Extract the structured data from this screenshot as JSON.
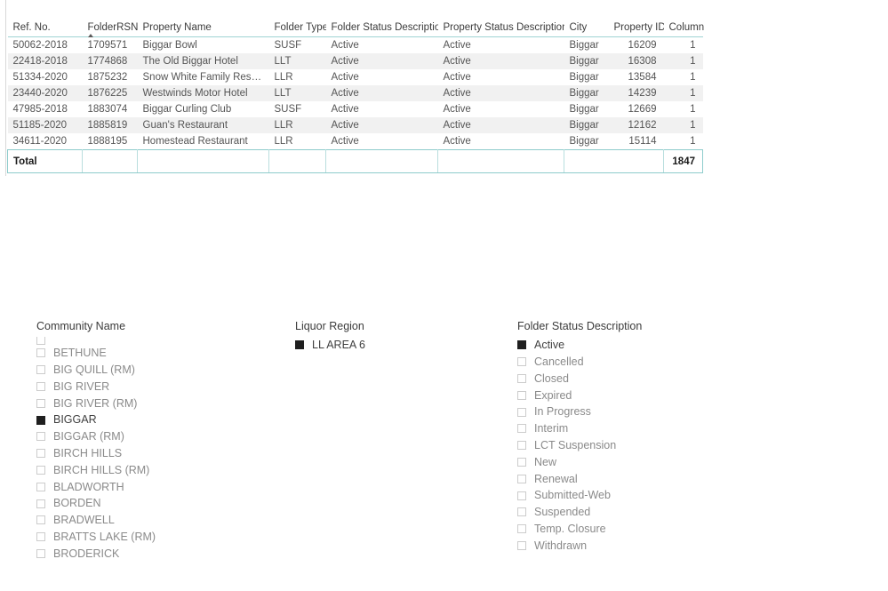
{
  "table": {
    "name": "property-folder-table",
    "columns": [
      {
        "key": "ref_no",
        "label": "Ref. No.",
        "align": "left",
        "sorted": false
      },
      {
        "key": "folder_rsn",
        "label": "FolderRSN",
        "align": "left",
        "sorted": true,
        "sort_direction": "asc"
      },
      {
        "key": "property_name",
        "label": "Property Name",
        "align": "left",
        "sorted": false
      },
      {
        "key": "folder_type",
        "label": "Folder Type",
        "align": "left",
        "sorted": false
      },
      {
        "key": "folder_status_description",
        "label": "Folder Status Description",
        "align": "left",
        "sorted": false
      },
      {
        "key": "property_status_description",
        "label": "Property Status Description",
        "align": "left",
        "sorted": false
      },
      {
        "key": "city",
        "label": "City",
        "align": "left",
        "sorted": false
      },
      {
        "key": "property_id",
        "label": "Property ID",
        "align": "right",
        "sorted": false
      },
      {
        "key": "column",
        "label": "Column",
        "align": "right",
        "sorted": false
      }
    ],
    "rows": [
      {
        "ref_no": "50062-2018",
        "folder_rsn": "1709571",
        "property_name": "Biggar Bowl",
        "folder_type": "SUSF",
        "folder_status_description": "Active",
        "property_status_description": "Active",
        "city": "Biggar",
        "property_id": "16209",
        "column": "1"
      },
      {
        "ref_no": "22418-2018",
        "folder_rsn": "1774868",
        "property_name": "The Old Biggar Hotel",
        "folder_type": "LLT",
        "folder_status_description": "Active",
        "property_status_description": "Active",
        "city": "Biggar",
        "property_id": "16308",
        "column": "1"
      },
      {
        "ref_no": "51334-2020",
        "folder_rsn": "1875232",
        "property_name": "Snow White Family Restaurant",
        "folder_type": "LLR",
        "folder_status_description": "Active",
        "property_status_description": "Active",
        "city": "Biggar",
        "property_id": "13584",
        "column": "1"
      },
      {
        "ref_no": "23440-2020",
        "folder_rsn": "1876225",
        "property_name": "Westwinds Motor Hotel",
        "folder_type": "LLT",
        "folder_status_description": "Active",
        "property_status_description": "Active",
        "city": "Biggar",
        "property_id": "14239",
        "column": "1"
      },
      {
        "ref_no": "47985-2018",
        "folder_rsn": "1883074",
        "property_name": "Biggar Curling Club",
        "folder_type": "SUSF",
        "folder_status_description": "Active",
        "property_status_description": "Active",
        "city": "Biggar",
        "property_id": "12669",
        "column": "1"
      },
      {
        "ref_no": "51185-2020",
        "folder_rsn": "1885819",
        "property_name": "Guan's Restaurant",
        "folder_type": "LLR",
        "folder_status_description": "Active",
        "property_status_description": "Active",
        "city": "Biggar",
        "property_id": "12162",
        "column": "1"
      },
      {
        "ref_no": "34611-2020",
        "folder_rsn": "1888195",
        "property_name": "Homestead Restaurant",
        "folder_type": "LLR",
        "folder_status_description": "Active",
        "property_status_description": "Active",
        "city": "Biggar",
        "property_id": "15114",
        "column": "1"
      }
    ],
    "total_row": {
      "label": "Total",
      "ref_no": "Total",
      "folder_rsn": "",
      "property_name": "",
      "folder_type": "",
      "folder_status_description": "",
      "property_status_description": "",
      "city": "",
      "property_id": "",
      "column": "1847"
    }
  },
  "slicers": {
    "community": {
      "title": "Community Name",
      "items": [
        {
          "label": "",
          "checked": false,
          "clipped": true
        },
        {
          "label": "BETHUNE",
          "checked": false
        },
        {
          "label": "BIG QUILL (RM)",
          "checked": false
        },
        {
          "label": "BIG RIVER",
          "checked": false
        },
        {
          "label": "BIG RIVER (RM)",
          "checked": false
        },
        {
          "label": "BIGGAR",
          "checked": true
        },
        {
          "label": "BIGGAR (RM)",
          "checked": false
        },
        {
          "label": "BIRCH HILLS",
          "checked": false
        },
        {
          "label": "BIRCH HILLS (RM)",
          "checked": false
        },
        {
          "label": "BLADWORTH",
          "checked": false
        },
        {
          "label": "BORDEN",
          "checked": false
        },
        {
          "label": "BRADWELL",
          "checked": false
        },
        {
          "label": "BRATTS LAKE (RM)",
          "checked": false
        },
        {
          "label": "BRODERICK",
          "checked": false
        }
      ]
    },
    "liquor_region": {
      "title": "Liquor Region",
      "items": [
        {
          "label": "LL AREA 6",
          "checked": true
        }
      ]
    },
    "folder_status": {
      "title": "Folder Status Description",
      "items": [
        {
          "label": "Active",
          "checked": true
        },
        {
          "label": "Cancelled",
          "checked": false
        },
        {
          "label": "Closed",
          "checked": false
        },
        {
          "label": "Expired",
          "checked": false
        },
        {
          "label": "In Progress",
          "checked": false
        },
        {
          "label": "Interim",
          "checked": false
        },
        {
          "label": "LCT Suspension",
          "checked": false
        },
        {
          "label": "New",
          "checked": false
        },
        {
          "label": "Renewal",
          "checked": false
        },
        {
          "label": "Submitted-Web",
          "checked": false
        },
        {
          "label": "Suspended",
          "checked": false
        },
        {
          "label": "Temp. Closure",
          "checked": false
        },
        {
          "label": "Withdrawn",
          "checked": false
        }
      ]
    }
  },
  "colors": {
    "table_accent": "#9fd3d3",
    "total_border": "#8ecccc",
    "row_alt": "#f1f1f1",
    "checkbox_checked": "#1f1f1f",
    "checkbox_border": "#cccccc",
    "text_primary": "#3b3b3b",
    "text_secondary": "#8a8a8a"
  }
}
